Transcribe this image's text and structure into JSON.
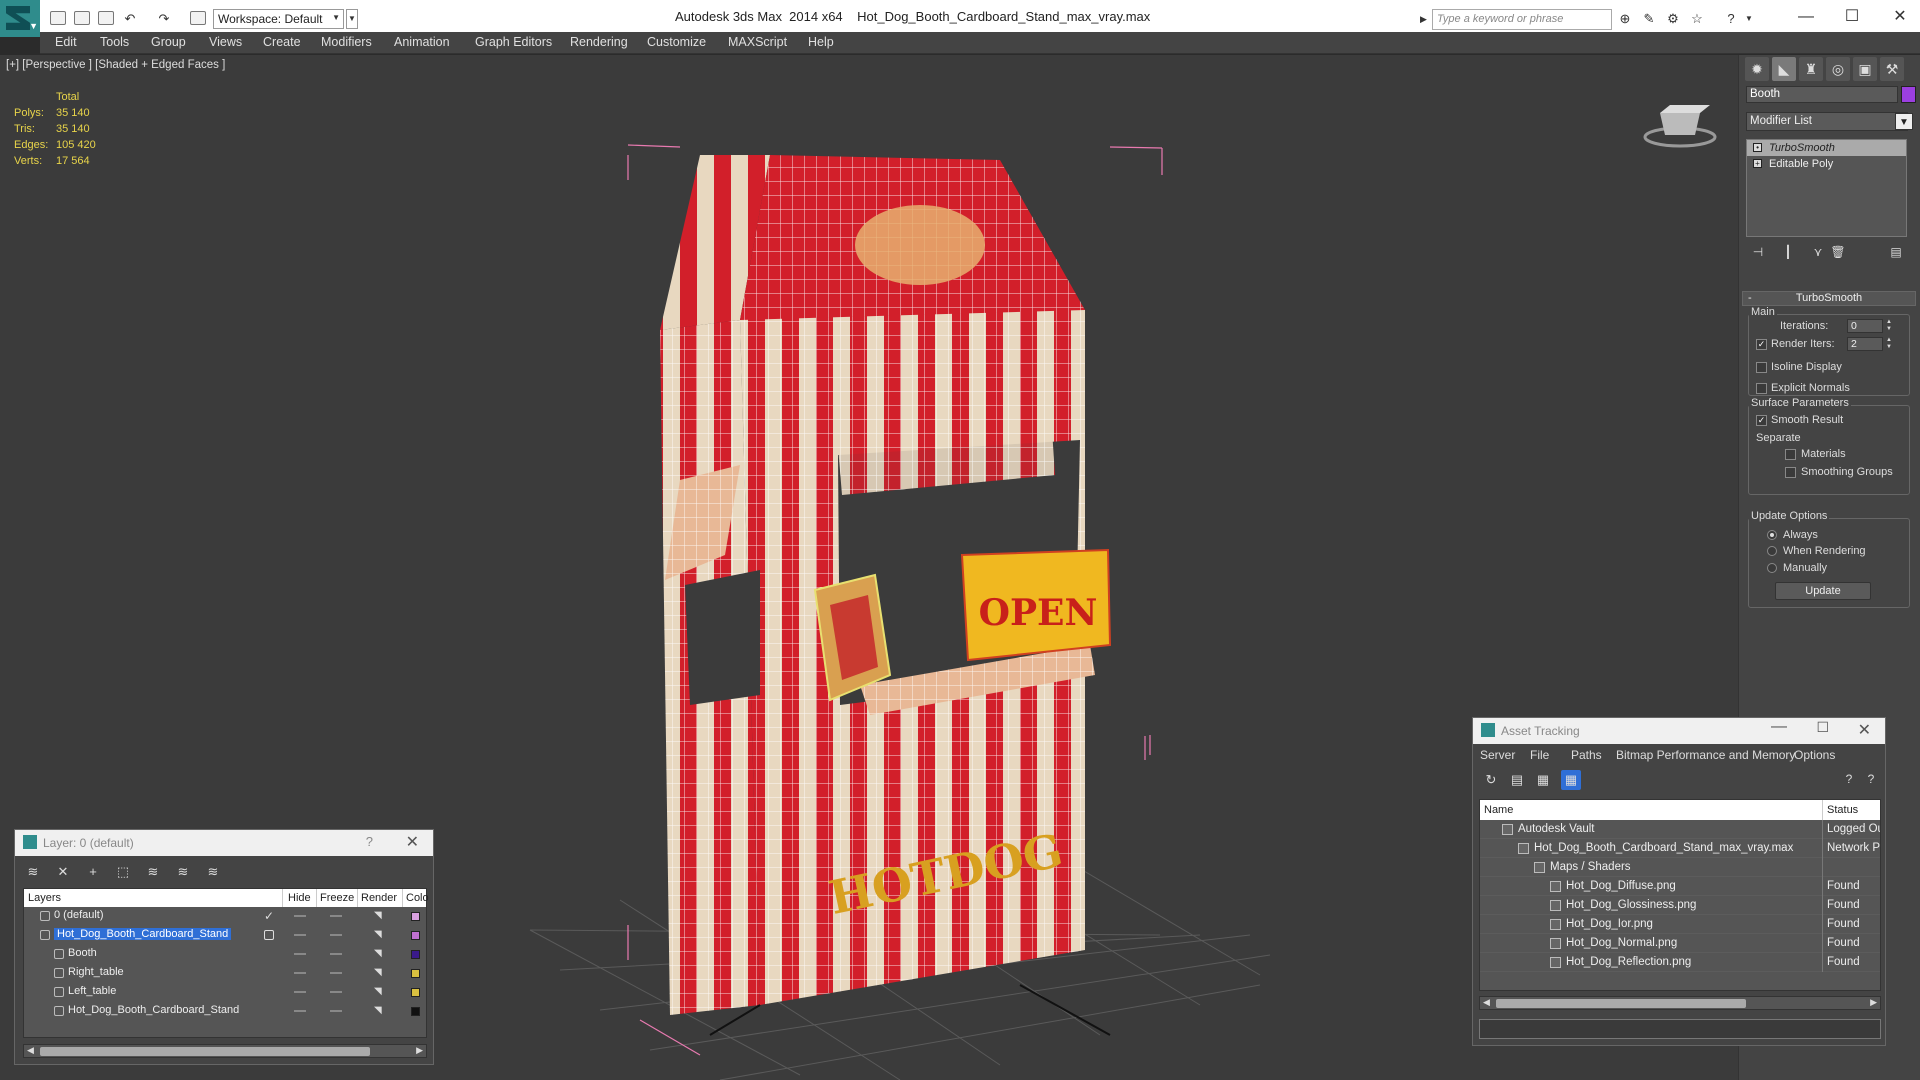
{
  "titlebar": {
    "workspace": "Workspace: Default",
    "app_name": "Autodesk 3ds Max  2014 x64",
    "file_name": "Hot_Dog_Booth_Cardboard_Stand_max_vray.max",
    "search_placeholder": "Type a keyword or phrase"
  },
  "menu": [
    "Edit",
    "Tools",
    "Group",
    "Views",
    "Create",
    "Modifiers",
    "Animation",
    "Graph Editors",
    "Rendering",
    "Customize",
    "MAXScript",
    "Help"
  ],
  "viewport": {
    "label": "[+] [Perspective ] [Shaded + Edged Faces ]",
    "stats": {
      "header": "Total",
      "rows": [
        {
          "k": "Polys:",
          "v": "35 140"
        },
        {
          "k": "Tris:",
          "v": "35 140"
        },
        {
          "k": "Edges:",
          "v": "105 420"
        },
        {
          "k": "Verts:",
          "v": "17 564"
        }
      ]
    },
    "signs": {
      "roof": "",
      "open": "OPEN",
      "front": "HOTDOG"
    }
  },
  "command_panel": {
    "object_name": "Booth",
    "object_color": "#9b3fe0",
    "modifier_list": "Modifier List",
    "stack": [
      "TurboSmooth",
      "Editable Poly"
    ],
    "rollout": "TurboSmooth",
    "main_group": "Main",
    "iterations_label": "Iterations:",
    "iterations_value": "0",
    "render_iters_label": "Render Iters:",
    "render_iters_value": "2",
    "isoline": "Isoline Display",
    "explicit_normals": "Explicit Normals",
    "surface_group": "Surface Parameters",
    "smooth_result": "Smooth Result",
    "separate": "Separate",
    "materials": "Materials",
    "smoothing_groups": "Smoothing Groups",
    "update_group": "Update Options",
    "always": "Always",
    "when_rendering": "When Rendering",
    "manually": "Manually",
    "update_button": "Update"
  },
  "layer_dialog": {
    "title": "Layer: 0 (default)",
    "help": "?",
    "columns": [
      "Layers",
      "Hide",
      "Freeze",
      "Render",
      "Colo"
    ],
    "rows": [
      {
        "name": "0 (default)",
        "color": "#d9a0e0",
        "indent": 0
      },
      {
        "name": "Hot_Dog_Booth_Cardboard_Stand",
        "color": "#c070d0",
        "indent": 0
      },
      {
        "name": "Booth",
        "color": "#3a1a8a",
        "indent": 1
      },
      {
        "name": "Right_table",
        "color": "#d9c040",
        "indent": 1
      },
      {
        "name": "Left_table",
        "color": "#d9c040",
        "indent": 1
      },
      {
        "name": "Hot_Dog_Booth_Cardboard_Stand",
        "color": "#111111",
        "indent": 1
      }
    ]
  },
  "asset_tracking": {
    "title": "Asset Tracking",
    "menu": [
      "Server",
      "File",
      "Paths",
      "Bitmap Performance and Memory",
      "Options"
    ],
    "columns": [
      "Name",
      "Status"
    ],
    "rows": [
      {
        "name": "Autodesk Vault",
        "status": "Logged Ou",
        "indent": 0
      },
      {
        "name": "Hot_Dog_Booth_Cardboard_Stand_max_vray.max",
        "status": "Network Pa",
        "indent": 1
      },
      {
        "name": "Maps / Shaders",
        "status": "",
        "indent": 2
      },
      {
        "name": "Hot_Dog_Diffuse.png",
        "status": "Found",
        "indent": 3
      },
      {
        "name": "Hot_Dog_Glossiness.png",
        "status": "Found",
        "indent": 3
      },
      {
        "name": "Hot_Dog_Ior.png",
        "status": "Found",
        "indent": 3
      },
      {
        "name": "Hot_Dog_Normal.png",
        "status": "Found",
        "indent": 3
      },
      {
        "name": "Hot_Dog_Reflection.png",
        "status": "Found",
        "indent": 3
      }
    ]
  }
}
